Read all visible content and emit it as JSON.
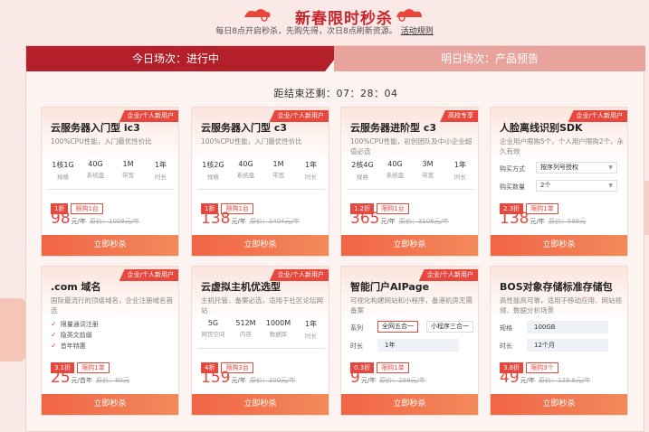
{
  "header": {
    "title": "新春限时秒杀",
    "subtitle": "每日8点开启秒杀，先购先得，次日8点刷新资源。",
    "rules_link": "活动规则"
  },
  "tabs": {
    "today": "今日场次：进行中",
    "tomorrow": "明日场次：产品预告"
  },
  "countdown": "距结束还剩：07：28：04",
  "colors": {
    "accent": "#e7473c",
    "tab": "#b3202a",
    "button": "#f16445"
  },
  "cards": [
    {
      "title": "云服务器入门型 ic3",
      "tag": "企业/个人新用户",
      "desc": "100%CPU性能，入门最优性价比",
      "specs": [
        {
          "v": "1核1G",
          "l": "规格"
        },
        {
          "v": "40G",
          "l": "系统盘"
        },
        {
          "v": "1M",
          "l": "带宽"
        },
        {
          "v": "1年",
          "l": "时长"
        }
      ],
      "discount": "1折",
      "limit": "限购1台",
      "price": "98",
      "unit": "元/年",
      "orig": "原价：1008元/年",
      "buy": "立即秒杀"
    },
    {
      "title": "云服务器入门型 c3",
      "tag": "企业/个人新用户",
      "desc": "100%CPU性能，入门最优性价比",
      "specs": [
        {
          "v": "1核2G",
          "l": "规格"
        },
        {
          "v": "40G",
          "l": "系统盘"
        },
        {
          "v": "1M",
          "l": "带宽"
        },
        {
          "v": "1年",
          "l": "时长"
        }
      ],
      "discount": "1折",
      "limit": "限购1台",
      "price": "138",
      "unit": "元/年",
      "orig": "原价：1404元/年",
      "buy": "立即秒杀"
    },
    {
      "title": "云服务器进阶型 c3",
      "tag": "高校专享",
      "desc": "100%CPU性能，初创团队及中小企业超值必选",
      "specs": [
        {
          "v": "2核4G",
          "l": "规格"
        },
        {
          "v": "40G",
          "l": "系统盘"
        },
        {
          "v": "3M",
          "l": "带宽"
        },
        {
          "v": "1年",
          "l": "时长"
        }
      ],
      "discount": "1.2折",
      "limit": "限购1台",
      "price": "365",
      "unit": "元/年",
      "orig": "原价：3108元/年",
      "buy": "立即秒杀"
    },
    {
      "title": "人脸离线识别SDK",
      "tag": "企业/个人新用户",
      "desc": "企业用户限购5个，个人用户限购2个，永久有效",
      "sel1_label": "购买方式",
      "sel1_value": "按序列号授权",
      "sel2_label": "购买数量",
      "sel2_value": "2个",
      "discount": "2.3折",
      "limit": "限购1单",
      "price": "138",
      "unit": "元/年",
      "orig": "原价：598元",
      "buy": "立即秒杀"
    },
    {
      "title": ".com 域名",
      "tag": "企业/个人新用户",
      "desc": "国际最流行的顶级域名，企业注册域名首选",
      "checks": [
        "限量通词注册",
        "隐英文前缀",
        "首年特惠"
      ],
      "discount": "3.1折",
      "limit": "限购1单",
      "price": "25",
      "unit": "元/首年",
      "orig": "原价：80元",
      "buy": "立即秒杀"
    },
    {
      "title": "云虚拟主机优选型",
      "tag": "企业/个人新用户",
      "desc": "主机托管、备案必选，适用于社区论坛网站",
      "specs": [
        {
          "v": "5G",
          "l": "网页空间"
        },
        {
          "v": "512M",
          "l": "内存"
        },
        {
          "v": "1000M",
          "l": "数据库"
        },
        {
          "v": "1年",
          "l": "时长"
        }
      ],
      "discount": "4折",
      "limit": "限购3台",
      "price": "159",
      "unit": "元/年",
      "orig": "原价：300元/年",
      "buy": "立即秒杀"
    },
    {
      "title": "智能门户AIPage",
      "tag": "企业/个人新用户",
      "desc": "可视化构建网站和小程序，备港机房无需备案",
      "row1_label": "系列",
      "row1_opts": [
        "全网五合一",
        "小程序三合一"
      ],
      "row2_label": "时长",
      "row2_value": "1年",
      "discount": "0.3折",
      "limit": "限购1单",
      "price": "9",
      "unit": "元/年",
      "orig": "原价：298元/年",
      "buy": "立即秒杀"
    },
    {
      "title": "BOS对象存储标准存储包",
      "tag": "",
      "desc": "高性能高可靠，适用于移动应用、网站视频、数据分析场景",
      "row1_label": "规格",
      "row1_value": "100GB",
      "row2_label": "时长",
      "row2_value": "12个月",
      "discount": "3.8折",
      "limit": "限购3个",
      "price": "49",
      "unit": "元/年",
      "orig": "原价：129.6元/年",
      "buy": "立即秒杀"
    }
  ]
}
